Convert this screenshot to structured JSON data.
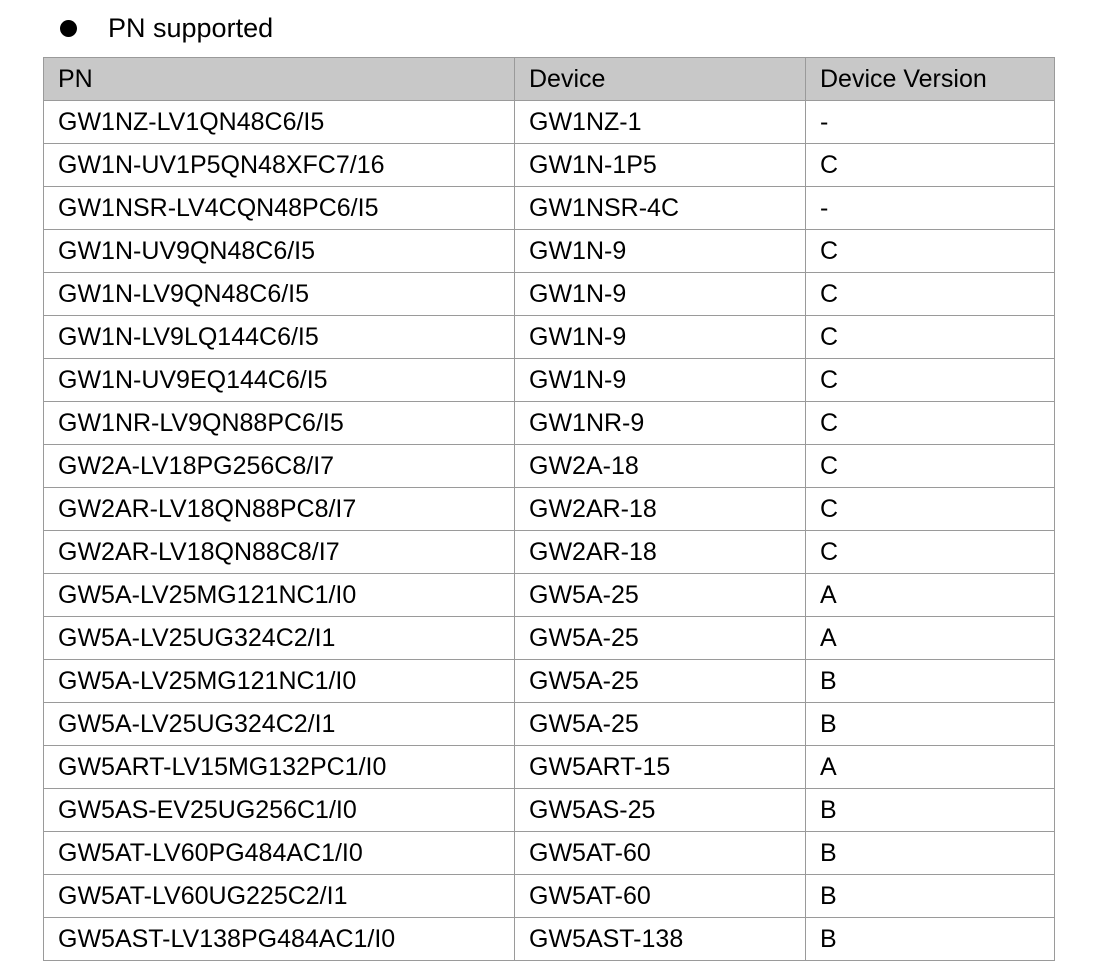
{
  "heading": "PN supported",
  "table": {
    "headers": [
      "PN",
      "Device",
      "Device Version"
    ],
    "rows": [
      [
        "GW1NZ-LV1QN48C6/I5",
        "GW1NZ-1",
        "-"
      ],
      [
        "GW1N-UV1P5QN48XFC7/16",
        "GW1N-1P5",
        "C"
      ],
      [
        "GW1NSR-LV4CQN48PC6/I5",
        "GW1NSR-4C",
        "-"
      ],
      [
        "GW1N-UV9QN48C6/I5",
        "GW1N-9",
        "C"
      ],
      [
        "GW1N-LV9QN48C6/I5",
        "GW1N-9",
        "C"
      ],
      [
        "GW1N-LV9LQ144C6/I5",
        "GW1N-9",
        "C"
      ],
      [
        "GW1N-UV9EQ144C6/I5",
        "GW1N-9",
        "C"
      ],
      [
        "GW1NR-LV9QN88PC6/I5",
        "GW1NR-9",
        "C"
      ],
      [
        "GW2A-LV18PG256C8/I7",
        "GW2A-18",
        "C"
      ],
      [
        "GW2AR-LV18QN88PC8/I7",
        "GW2AR-18",
        "C"
      ],
      [
        "GW2AR-LV18QN88C8/I7",
        "GW2AR-18",
        "C"
      ],
      [
        "GW5A-LV25MG121NC1/I0",
        "GW5A-25",
        "A"
      ],
      [
        "GW5A-LV25UG324C2/I1",
        "GW5A-25",
        "A"
      ],
      [
        "GW5A-LV25MG121NC1/I0",
        "GW5A-25",
        "B"
      ],
      [
        "GW5A-LV25UG324C2/I1",
        "GW5A-25",
        "B"
      ],
      [
        "GW5ART-LV15MG132PC1/I0",
        "GW5ART-15",
        "A"
      ],
      [
        "GW5AS-EV25UG256C1/I0",
        "GW5AS-25",
        "B"
      ],
      [
        "GW5AT-LV60PG484AC1/I0",
        "GW5AT-60",
        "B"
      ],
      [
        "GW5AT-LV60UG225C2/I1",
        "GW5AT-60",
        "B"
      ],
      [
        "GW5AST-LV138PG484AC1/I0",
        "GW5AST-138",
        "B"
      ]
    ]
  }
}
